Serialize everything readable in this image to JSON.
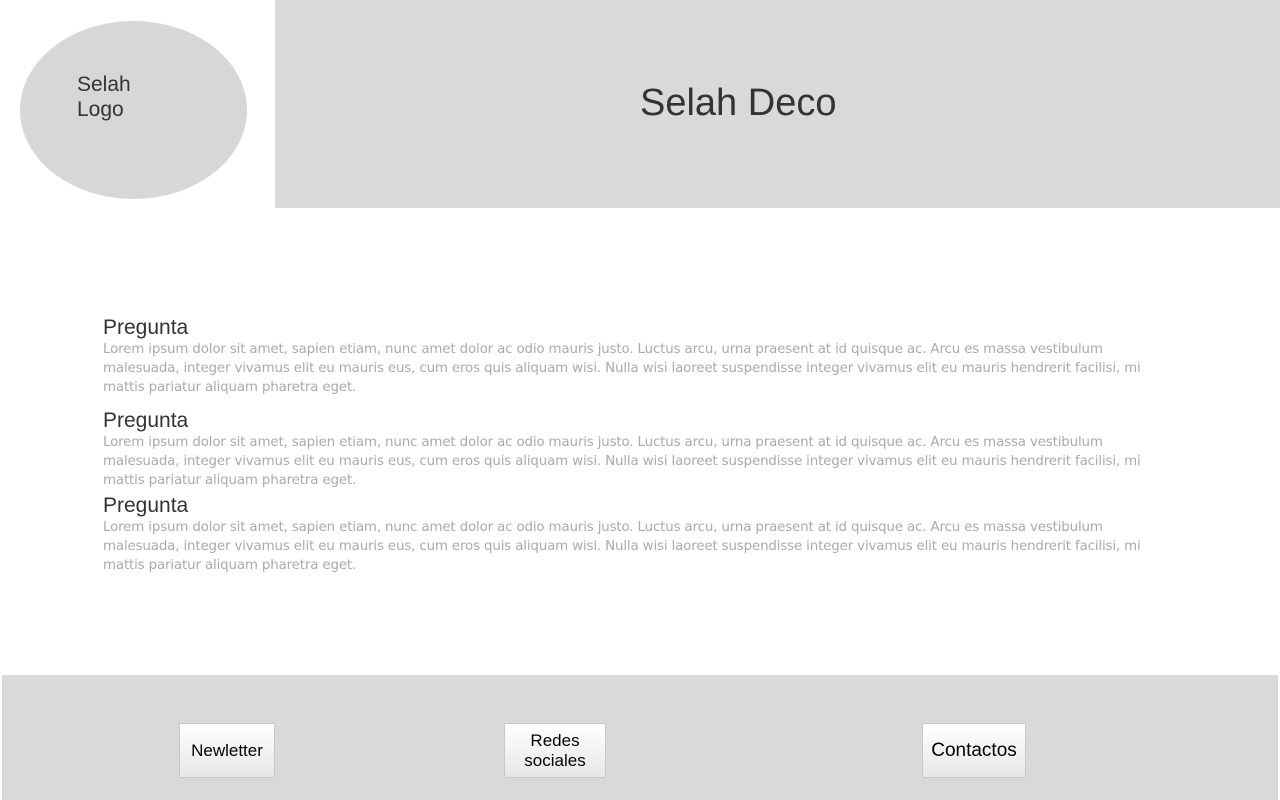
{
  "header": {
    "logo_text": "Selah\nLogo",
    "site_title": "Selah Deco"
  },
  "faq": [
    {
      "question": "Pregunta",
      "answer": "Lorem ipsum dolor sit amet, sapien etiam, nunc amet dolor ac odio mauris justo. Luctus arcu, urna praesent at id quisque ac. Arcu es massa vestibulum malesuada, integer vivamus elit eu mauris eus, cum eros quis aliquam wisi. Nulla wisi laoreet suspendisse integer vivamus elit eu mauris hendrerit facilisi, mi mattis pariatur aliquam pharetra eget."
    },
    {
      "question": "Pregunta",
      "answer": "Lorem ipsum dolor sit amet, sapien etiam, nunc amet dolor ac odio mauris justo. Luctus arcu, urna praesent at id quisque ac. Arcu es massa vestibulum malesuada, integer vivamus elit eu mauris eus, cum eros quis aliquam wisi. Nulla wisi laoreet suspendisse integer vivamus elit eu mauris hendrerit facilisi, mi mattis pariatur aliquam pharetra eget."
    },
    {
      "question": "Pregunta",
      "answer": "Lorem ipsum dolor sit amet, sapien etiam, nunc amet dolor ac odio mauris justo. Luctus arcu, urna praesent at id quisque ac. Arcu es massa vestibulum malesuada, integer vivamus elit eu mauris eus, cum eros quis aliquam wisi. Nulla wisi laoreet suspendisse integer vivamus elit eu mauris hendrerit facilisi, mi mattis pariatur aliquam pharetra eget."
    }
  ],
  "footer": {
    "newsletter_label": "Newletter",
    "social_label": "Redes\nsociales",
    "contact_label": "Contactos"
  },
  "colors": {
    "panel_gray": "#d9d9d9",
    "logo_gray": "#d7d7d7",
    "heading_text": "#333333",
    "body_text": "#aaaaaa"
  }
}
